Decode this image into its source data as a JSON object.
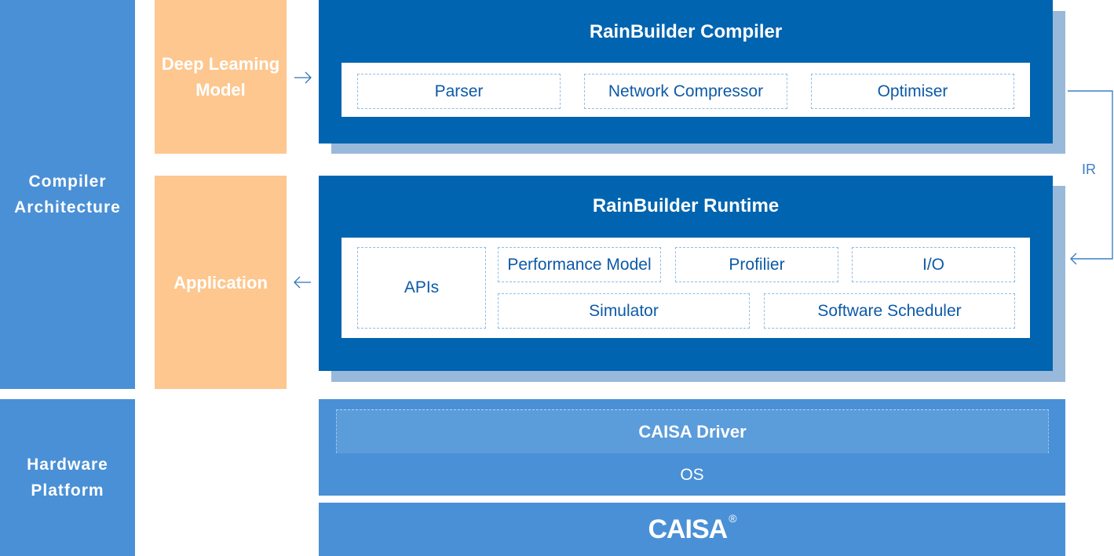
{
  "layers": {
    "compiler_architecture": "Compiler\nArchitecture",
    "hardware_platform": "Hardware\nPlatform"
  },
  "inputs": {
    "deep_learning_model": "Deep Leaming\nModel",
    "application": "Application"
  },
  "compiler": {
    "title": "RainBuilder Compiler",
    "modules": [
      "Parser",
      "Network Compressor",
      "Optimiser"
    ]
  },
  "runtime": {
    "title": "RainBuilder Runtime",
    "modules": {
      "apis": "APIs",
      "performance_model": "Performance Model",
      "profiler": "Profilier",
      "io": "I/O",
      "simulator": "Simulator",
      "software_scheduler": "Software Scheduler"
    }
  },
  "connector": {
    "label": "IR"
  },
  "hardware": {
    "driver": "CAISA Driver",
    "os": "OS",
    "logo": "CAISA",
    "logo_mark": "®"
  },
  "colors": {
    "layer_blue": "#4a90d6",
    "dark_blue": "#0064b0",
    "shadow_blue": "#99b9db",
    "orange": "#fdc78f",
    "module_text": "#0d5aa7"
  }
}
